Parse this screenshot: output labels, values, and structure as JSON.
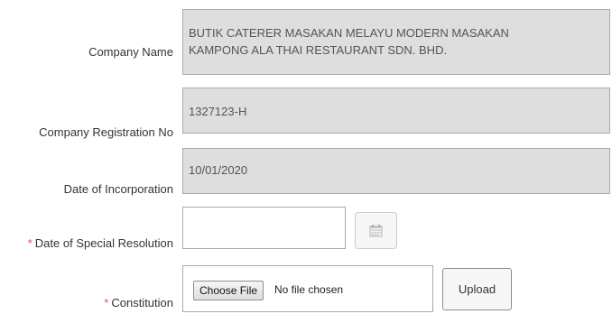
{
  "form": {
    "company_name": {
      "label": "Company Name",
      "value_line1": "BUTIK CATERER MASAKAN MELAYU MODERN MASAKAN",
      "value_line2": "KAMPONG ALA THAI RESTAURANT SDN. BHD."
    },
    "registration_no": {
      "label": "Company Registration No",
      "value": "1327123-H"
    },
    "incorporation_date": {
      "label": "Date of Incorporation",
      "value": "10/01/2020"
    },
    "special_resolution_date": {
      "required_mark": "*",
      "label": "Date of Special Resolution",
      "value": "",
      "calendar_icon": "calendar-icon"
    },
    "constitution": {
      "required_mark": "*",
      "label": "Constitution",
      "choose_file_label": "Choose File",
      "file_status": "No file chosen",
      "upload_label": "Upload"
    }
  },
  "colors": {
    "readonly_bg": "#dedede",
    "border": "#a9a9a9",
    "required": "#d9534f"
  }
}
